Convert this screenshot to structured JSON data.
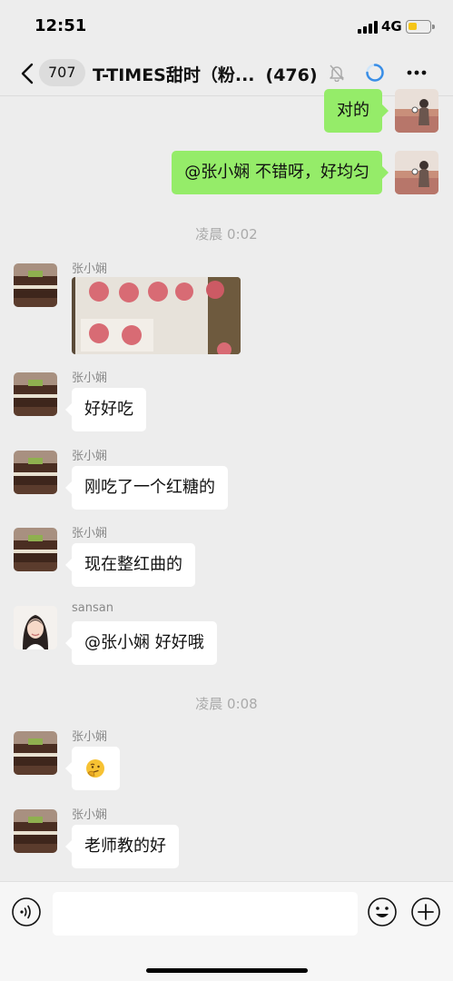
{
  "status_bar": {
    "time": "12:51",
    "network": "4G",
    "battery_level": 0.45,
    "battery_color": "#f5c518"
  },
  "nav": {
    "back_icon": "chevron-left-icon",
    "unread_count": "707",
    "title": "T-TIMES甜时（粉...",
    "member_count": "(476)",
    "mute_icon": "bell-off-icon",
    "sync_icon": "loading-ring-icon",
    "more_icon": "ellipsis-icon"
  },
  "colors": {
    "background": "#ededed",
    "outgoing_bubble": "#95ec69",
    "incoming_bubble": "#ffffff",
    "timestamp_text": "#aaaaaa"
  },
  "messages": [
    {
      "type": "text",
      "direction": "out",
      "text": "对的"
    },
    {
      "type": "text",
      "direction": "out",
      "text": "@张小娴 不错呀，好均匀"
    },
    {
      "type": "timestamp",
      "text": "凌晨 0:02"
    },
    {
      "type": "image",
      "direction": "in",
      "sender": "张小娴",
      "content": "photo of pink round candies on parchment paper"
    },
    {
      "type": "text",
      "direction": "in",
      "sender": "张小娴",
      "text": "好好吃"
    },
    {
      "type": "text",
      "direction": "in",
      "sender": "张小娴",
      "text": "刚吃了一个红糖的"
    },
    {
      "type": "text",
      "direction": "in",
      "sender": "张小娴",
      "text": "现在整红曲的"
    },
    {
      "type": "text",
      "direction": "in",
      "sender": "sansan",
      "text": "@张小娴 好好哦"
    },
    {
      "type": "timestamp",
      "text": "凌晨 0:08"
    },
    {
      "type": "emoji",
      "direction": "in",
      "sender": "张小娴",
      "content": "thinking-face-emoji"
    },
    {
      "type": "text",
      "direction": "in",
      "sender": "张小娴",
      "text": "老师教的好"
    }
  ],
  "input_bar": {
    "voice_icon": "voice-input-icon",
    "text_value": "",
    "emoji_icon": "smiley-face-icon",
    "plus_icon": "add-circle-icon"
  }
}
